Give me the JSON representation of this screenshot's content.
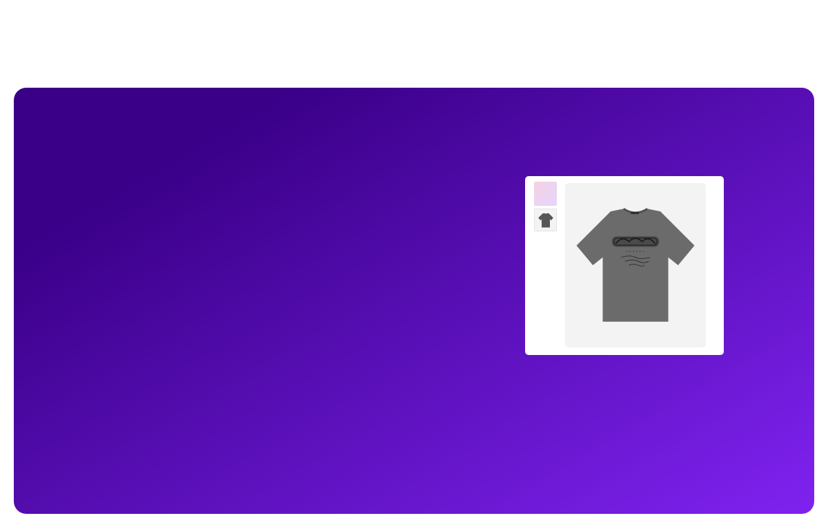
{
  "colors": {
    "page_background": "#ffffff",
    "hero_gradient_start": "#3a0088",
    "hero_gradient_end": "#7f22f0",
    "card_background": "#ffffff",
    "image_background": "#f3f3f3",
    "tshirt_body": "#6b6b6b",
    "thumb_gradient_start": "#f4d2e4",
    "thumb_gradient_end": "#e6d4fb"
  },
  "product_gallery": {
    "thumbnails": [
      {
        "icon": "gradient-swatch-thumbnail",
        "selected": false
      },
      {
        "icon": "tshirt-thumbnail",
        "selected": true
      }
    ],
    "main_image": {
      "icon": "gray-graphic-tshirt"
    }
  }
}
